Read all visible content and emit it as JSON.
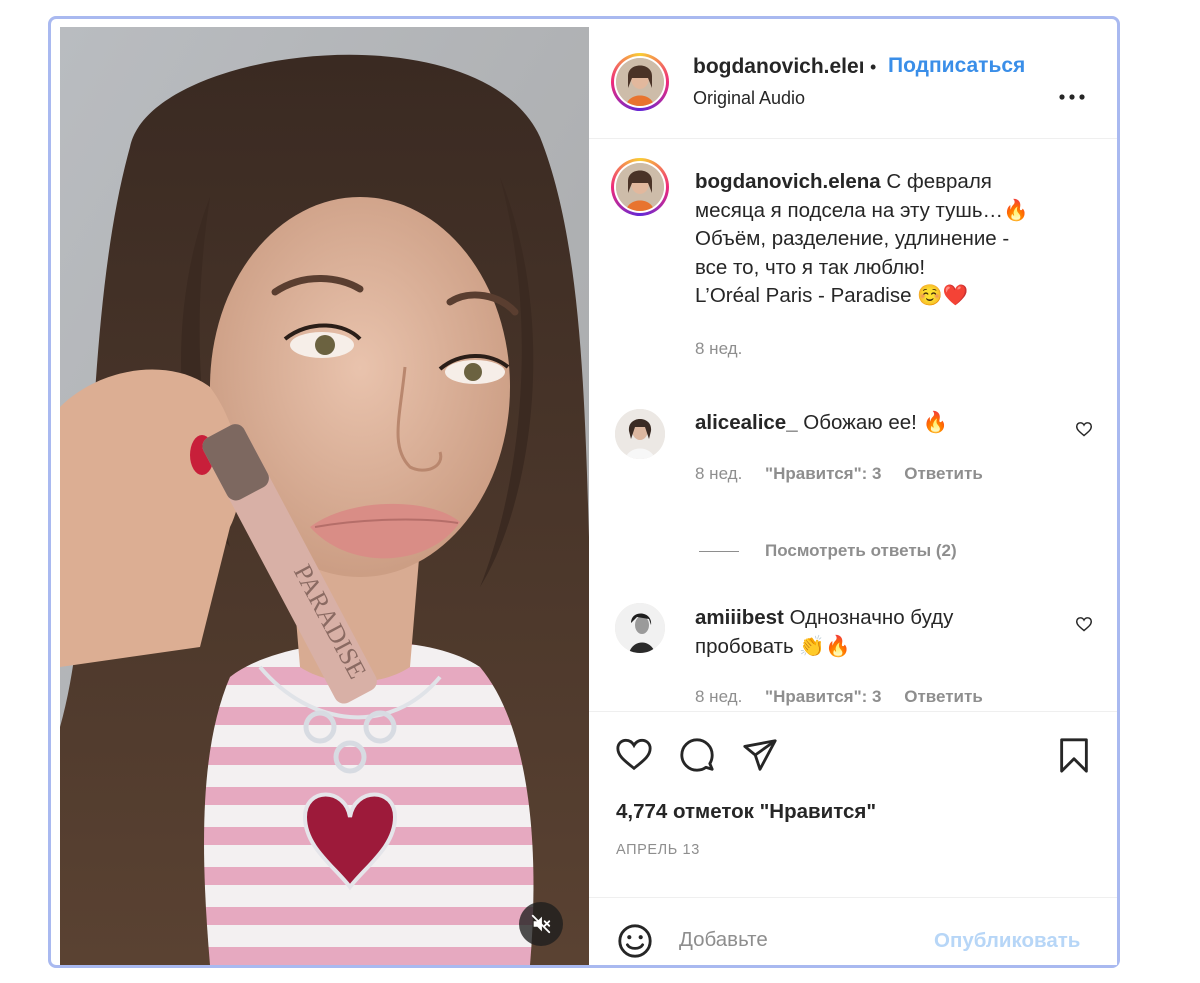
{
  "header": {
    "username": "bogdanovich.elena",
    "separator": "•",
    "follow_label": "Подписаться",
    "audio_label": "Original Audio",
    "more_icon": "more-horizontal-icon"
  },
  "caption": {
    "username": "bogdanovich.elena",
    "text_line1": "С февраля",
    "text_line2": "месяца я подсела на эту тушь…🔥",
    "text_line3": "Объём, разделение, удлинение -",
    "text_line4": "все то, что я так люблю!",
    "text_line5": "L’Oréal Paris - Paradise ☺️❤️",
    "time": "8 нед."
  },
  "comments": [
    {
      "username": "alicealice_",
      "text": "Обожаю ее! 🔥",
      "time": "8 нед.",
      "likes": "\"Нравится\": 3",
      "reply": "Ответить"
    },
    {
      "username": "amiiibest",
      "text": "Однозначно буду пробовать 👏🔥",
      "time": "8 нед.",
      "likes": "\"Нравится\": 3",
      "reply": "Ответить"
    }
  ],
  "view_replies": "Посмотреть ответы (2)",
  "actions": {
    "likes_count": "4,774 отметок \"Нравится\"",
    "date": "АПРЕЛЬ 13"
  },
  "add_comment": {
    "placeholder": "Добавьте",
    "publish_label": "Опубликовать"
  },
  "colors": {
    "accent": "#3a8ee8",
    "publish_disabled": "#b7d6f7",
    "secondary_text": "#8e8e8e",
    "frame_border": "#a9b9f0"
  }
}
